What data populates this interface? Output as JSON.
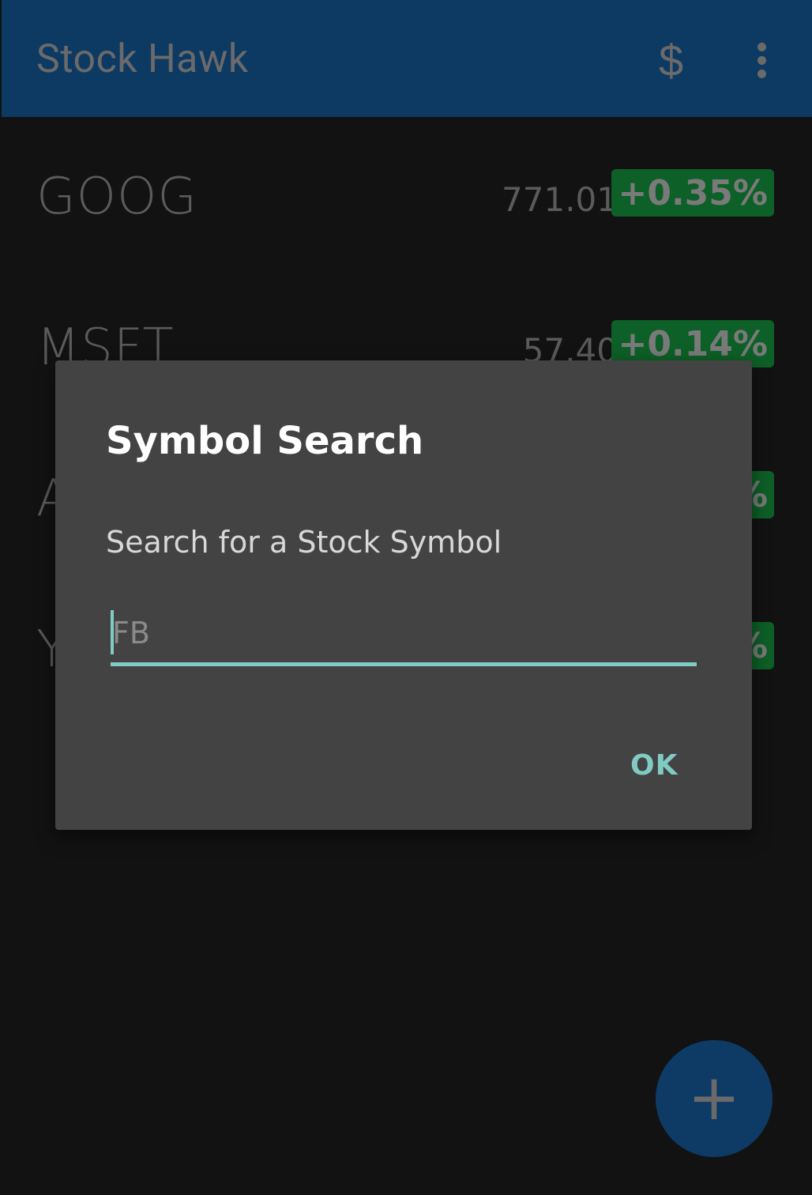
{
  "app": {
    "title": "Stock Hawk",
    "display_mode_icon": "dollar-icon",
    "overflow_icon": "more-vert-icon"
  },
  "stocks": [
    {
      "symbol": "GOOG",
      "price": "771.01",
      "change": "+0.35%"
    },
    {
      "symbol": "MSFT",
      "price": "57.40",
      "change": "+0.14%"
    },
    {
      "symbol": "A",
      "price": "",
      "change": "%"
    },
    {
      "symbol": "Y",
      "price": "",
      "change": "%"
    }
  ],
  "fab": {
    "label": "+"
  },
  "dialog": {
    "title": "Symbol Search",
    "message": "Search for a Stock Symbol",
    "input_value": "",
    "input_placeholder": "FB",
    "ok_label": "OK"
  },
  "colors": {
    "app_bar": "#0d3a63",
    "dialog_background": "#434343",
    "accent": "#80cbc4",
    "positive_change": "#0d6027"
  }
}
